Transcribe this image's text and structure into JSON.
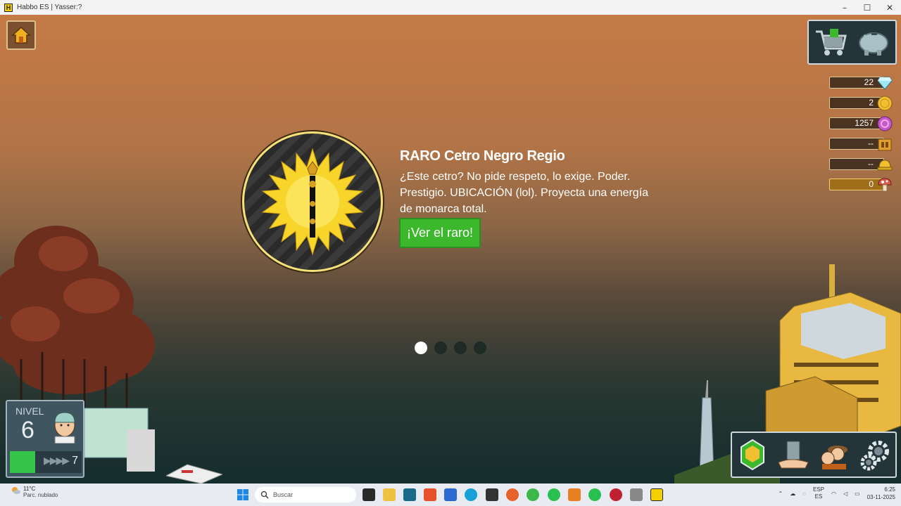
{
  "window": {
    "title": "Habbo ES | Yasser:?",
    "app_icon_letter": "H",
    "controls": [
      "–",
      "☐",
      "✕"
    ]
  },
  "hud": {
    "home_button": "home-icon",
    "shop_buttons": [
      "shop-cart-icon",
      "piggy-bank-icon"
    ],
    "currencies": [
      {
        "name": "diamonds",
        "value": "22",
        "icon": "diamond-icon"
      },
      {
        "name": "credits",
        "value": "2",
        "icon": "coin-icon"
      },
      {
        "name": "duckets",
        "value": "1257",
        "icon": "ducket-icon"
      },
      {
        "name": "event-currency",
        "value": "--",
        "icon": "gate-icon"
      },
      {
        "name": "builder",
        "value": "--",
        "icon": "helmet-icon"
      },
      {
        "name": "mushrooms",
        "value": "0",
        "icon": "mushroom-icon"
      }
    ]
  },
  "promo": {
    "title": "RARO Cetro Negro Regio",
    "description": "¿Este cetro? No pide respeto, lo exige. Poder. Prestigio. UBICACIÓN (lol). Proyecta una energía de monarca total.",
    "button_label": "¡Ver el raro!",
    "slide_count": 4,
    "active_slide": 1
  },
  "level": {
    "label": "NIVEL",
    "current": "6",
    "next": "7",
    "progress_fraction": 0.35,
    "arrows": "▶▶▶▶"
  },
  "toolbar": {
    "buttons": [
      "navigator-icon",
      "catalog-building-icon",
      "friends-icon",
      "settings-gear-icon"
    ]
  },
  "taskbar": {
    "weather_temp": "11°C",
    "weather_desc": "Parc. nublado",
    "search_placeholder": "Buscar",
    "lang_top": "ESP",
    "lang_bottom": "ES",
    "time": "6:25",
    "date": "03-11-2025"
  }
}
